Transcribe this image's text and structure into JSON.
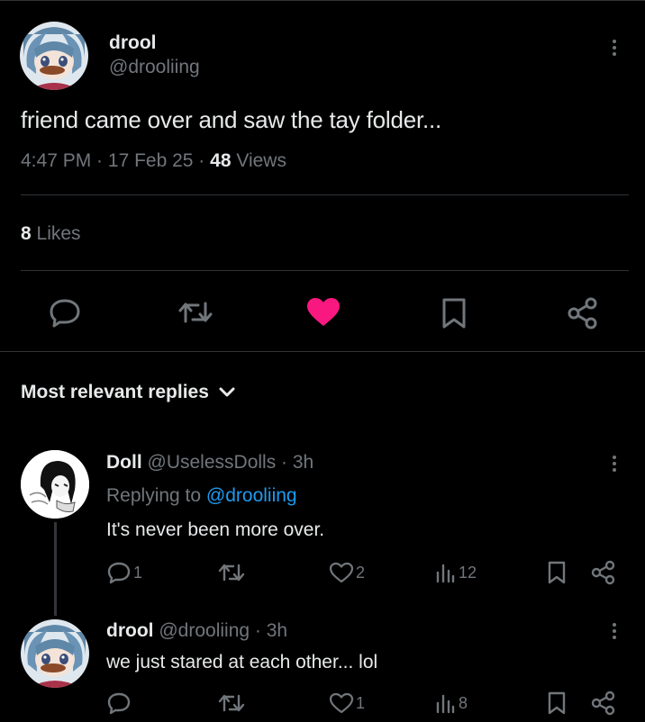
{
  "post": {
    "author_name": "drool",
    "author_handle": "@drooliing",
    "text": "friend came over and saw the tay folder...",
    "time": "4:47 PM",
    "date_sep": " · ",
    "date": "17 Feb 25",
    "views_sep": " · ",
    "views_count": "48",
    "views_label": " Views",
    "likes_count": "8",
    "likes_label": " Likes"
  },
  "replies_header": {
    "label": "Most relevant replies"
  },
  "replies": [
    {
      "name": "Doll",
      "handle": "@UselessDolls",
      "time_sep": " · ",
      "time": "3h",
      "replying_prefix": "Replying to ",
      "replying_handle": "@drooliing",
      "text": "It's never been more over.",
      "reply_count": "1",
      "like_count": "2",
      "view_count": "12"
    },
    {
      "name": "drool",
      "handle": "@drooliing",
      "time_sep": " · ",
      "time": "3h",
      "text": "we just stared at each other... lol",
      "like_count": "1",
      "view_count": "8"
    }
  ],
  "colors": {
    "background": "#000000",
    "text": "#e7e9ea",
    "muted": "#71767b",
    "like_active": "#f91880",
    "link": "#1d9bf0",
    "divider": "#2f3336"
  }
}
